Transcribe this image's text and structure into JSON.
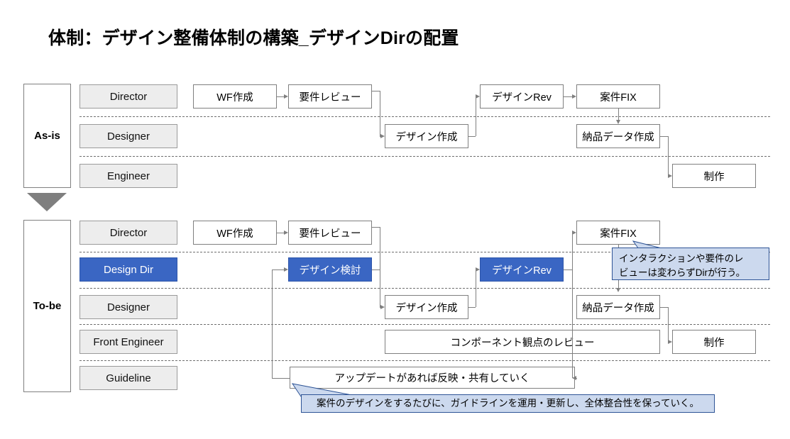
{
  "title": "体制：デザイン整備体制の構築_デザインDirの配置",
  "sections": [
    {
      "id": "as-is",
      "label": "As-is",
      "lanes": [
        {
          "id": "as-is-director",
          "role": "Director",
          "steps": [
            {
              "id": "wf-sakusei",
              "label": "WF作成"
            },
            {
              "id": "youken-review",
              "label": "要件レビュー"
            },
            {
              "id": "design-rev",
              "label": "デザインRev"
            },
            {
              "id": "anken-fix",
              "label": "案件FIX"
            }
          ]
        },
        {
          "id": "as-is-designer",
          "role": "Designer",
          "steps": [
            {
              "id": "design-sakusei",
              "label": "デザイン作成"
            },
            {
              "id": "nouhin-data",
              "label": "納品データ作成"
            }
          ]
        },
        {
          "id": "as-is-engineer",
          "role": "Engineer",
          "steps": [
            {
              "id": "seisaku",
              "label": "制作"
            }
          ]
        }
      ]
    },
    {
      "id": "to-be",
      "label": "To-be",
      "lanes": [
        {
          "id": "to-be-director",
          "role": "Director",
          "accent": false,
          "steps": [
            {
              "id": "wf-sakusei",
              "label": "WF作成"
            },
            {
              "id": "youken-review",
              "label": "要件レビュー"
            },
            {
              "id": "anken-fix",
              "label": "案件FIX"
            }
          ]
        },
        {
          "id": "to-be-design-dir",
          "role": "Design Dir",
          "accent": true,
          "steps": [
            {
              "id": "design-kentou",
              "label": "デザイン検討"
            },
            {
              "id": "design-rev",
              "label": "デザインRev"
            }
          ]
        },
        {
          "id": "to-be-designer",
          "role": "Designer",
          "accent": false,
          "steps": [
            {
              "id": "design-sakusei",
              "label": "デザイン作成"
            },
            {
              "id": "nouhin-data",
              "label": "納品データ作成"
            }
          ]
        },
        {
          "id": "to-be-front-engineer",
          "role": "Front Engineer",
          "accent": false,
          "steps": [
            {
              "id": "component-review",
              "label": "コンポーネント観点のレビュー"
            },
            {
              "id": "seisaku",
              "label": "制作"
            }
          ]
        },
        {
          "id": "to-be-guideline",
          "role": "Guideline",
          "accent": false,
          "steps": [
            {
              "id": "update-hanei",
              "label": "アップデートがあれば反映・共有していく"
            }
          ]
        }
      ]
    }
  ],
  "callouts": [
    {
      "id": "callout-dir-review",
      "line1": "インタラクションや要件のレ",
      "line2": "ビューは変わらずDirが行う。"
    },
    {
      "id": "callout-guideline",
      "text": "案件のデザインをするたびに、ガイドラインを運用・更新し、全体整合性を保っていく。"
    }
  ],
  "colors": {
    "accent": "#3a66c3",
    "role_fill": "#ededed",
    "callout_fill": "#ccd9ee",
    "callout_border": "#2e5496",
    "line": "#7f7f7f",
    "arrow_fill": "#7f7f7f"
  }
}
